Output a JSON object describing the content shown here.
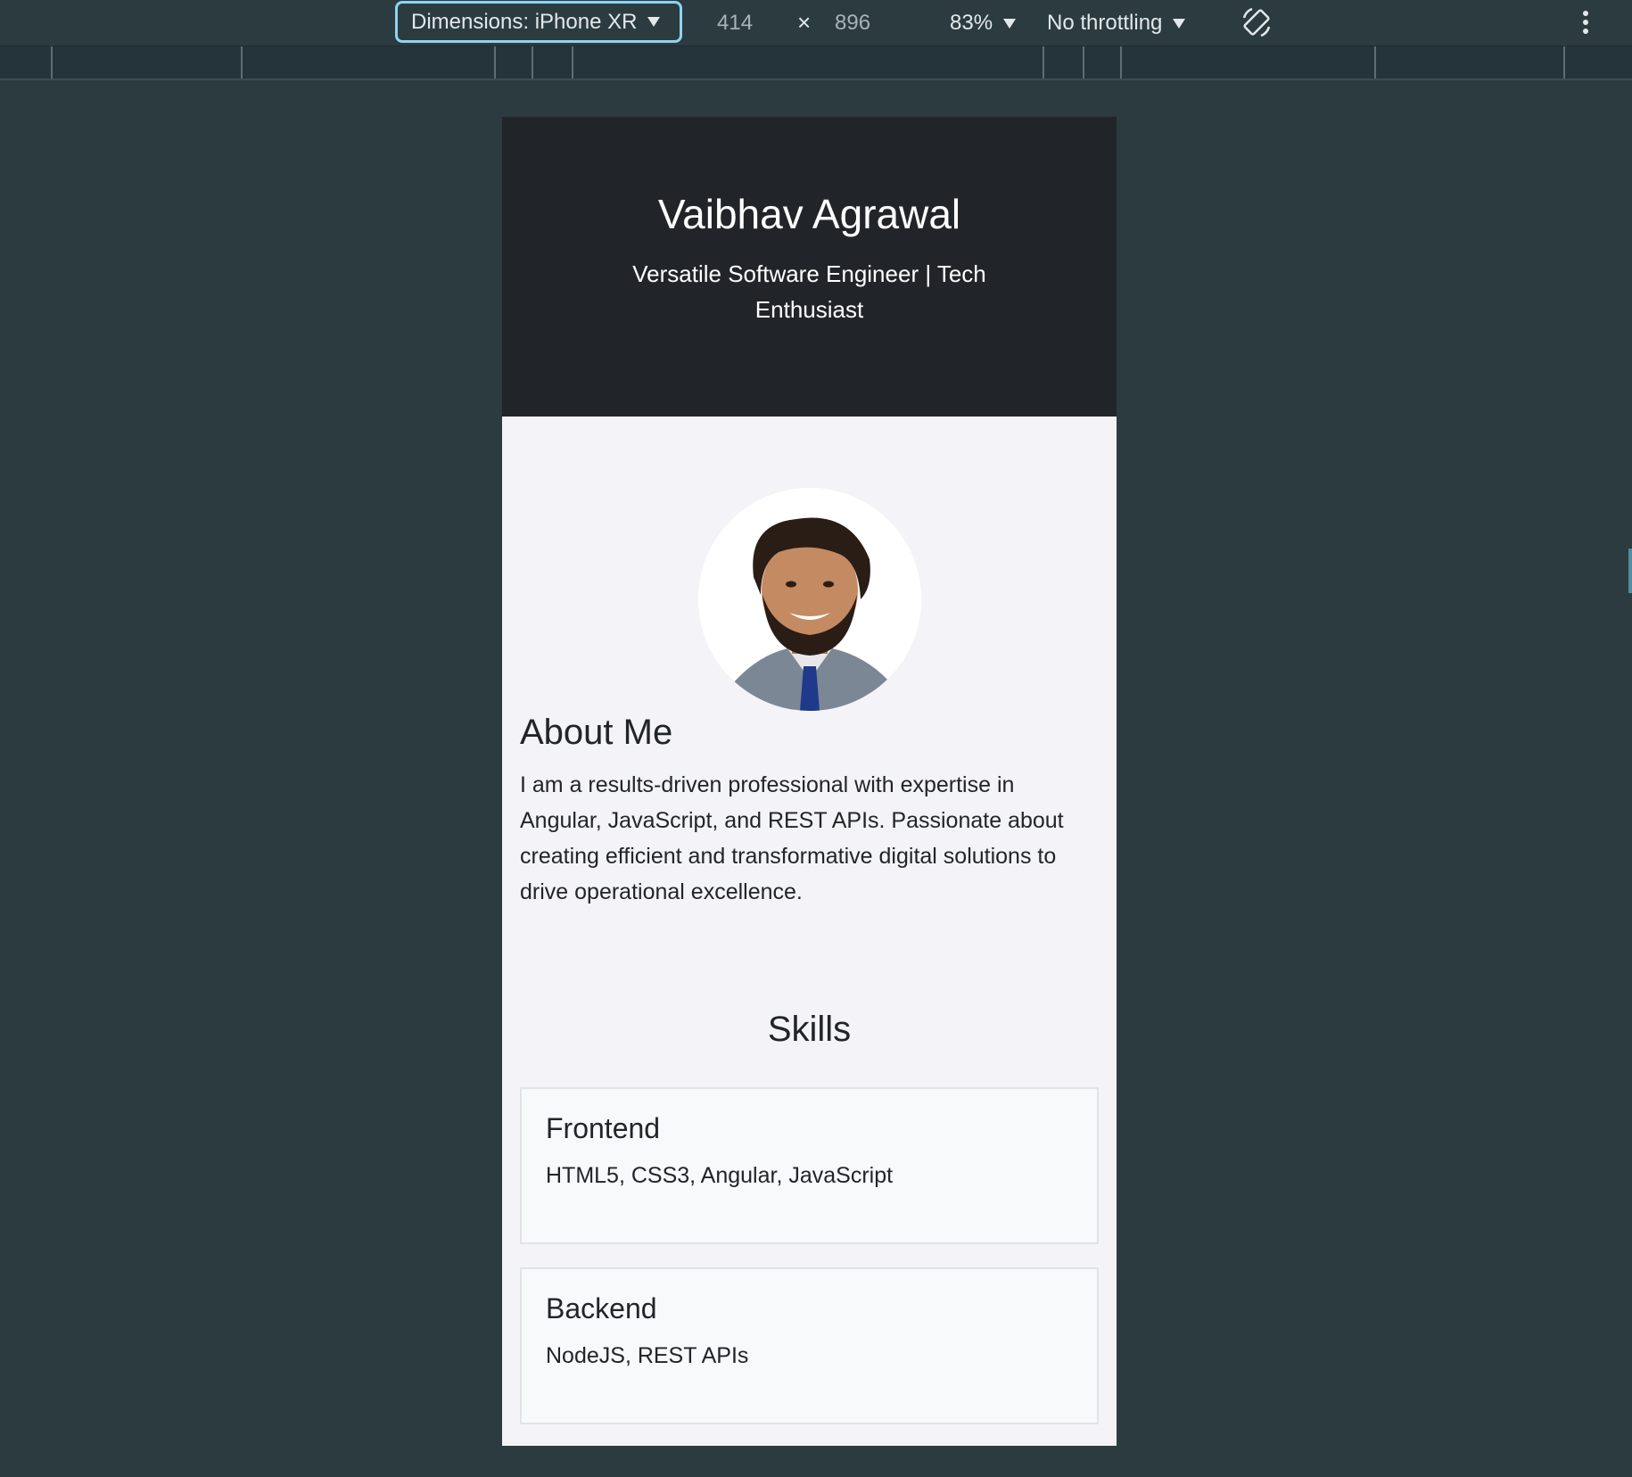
{
  "devtools": {
    "dimensions_label": "Dimensions: iPhone XR",
    "width": "414",
    "times": "×",
    "height": "896",
    "zoom": "83%",
    "throttling": "No throttling",
    "icons": [
      "caret-down-icon",
      "rotate-icon",
      "more-vert-icon"
    ]
  },
  "header": {
    "name": "Vaibhav Agrawal",
    "tagline": "Versatile Software Engineer | Tech Enthusiast"
  },
  "about": {
    "title": "About Me",
    "text": "I am a results-driven professional with expertise in Angular, JavaScript, and REST APIs. Passionate about creating efficient and transformative digital solutions to drive operational excellence."
  },
  "skills": {
    "title": "Skills",
    "items": [
      {
        "title": "Frontend",
        "body": "HTML5, CSS3, Angular, JavaScript"
      },
      {
        "title": "Backend",
        "body": "NodeJS, REST APIs"
      }
    ]
  },
  "colors": {
    "header_bg": "#212529",
    "page_bg": "#f4f4f8",
    "devtools_bg": "#2c3b40",
    "focus_ring": "#8fd3f0"
  }
}
